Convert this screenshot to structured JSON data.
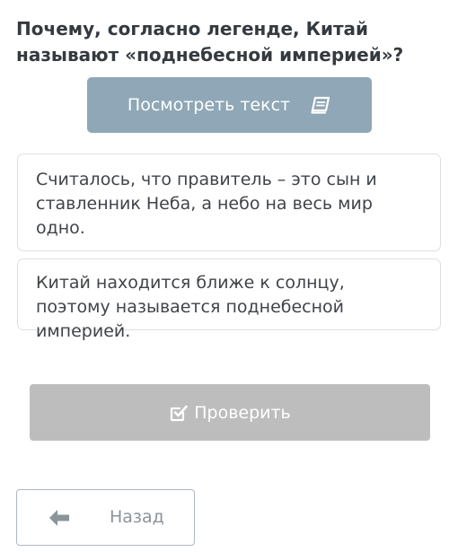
{
  "question": {
    "text": "Почему, согласно легенде, Китай называют «поднебесной империей»?"
  },
  "view_text_button": {
    "label": "Посмотреть текст",
    "icon": "book-icon"
  },
  "options": [
    {
      "text": "Считалось, что правитель – это сын и ставленник Неба, а небо на весь мир одно."
    },
    {
      "text": "Китай находится ближе к солнцу, поэтому называется поднебесной империей."
    }
  ],
  "check_button": {
    "label": "Проверить",
    "icon": "checkbox-check-icon"
  },
  "back_button": {
    "label": "Назад",
    "icon": "arrow-left-icon"
  },
  "colors": {
    "view_text_bg": "#8fa7b6",
    "check_disabled_bg": "#bdbdbd",
    "text_dark": "#343a40",
    "back_text": "#8a949b"
  }
}
